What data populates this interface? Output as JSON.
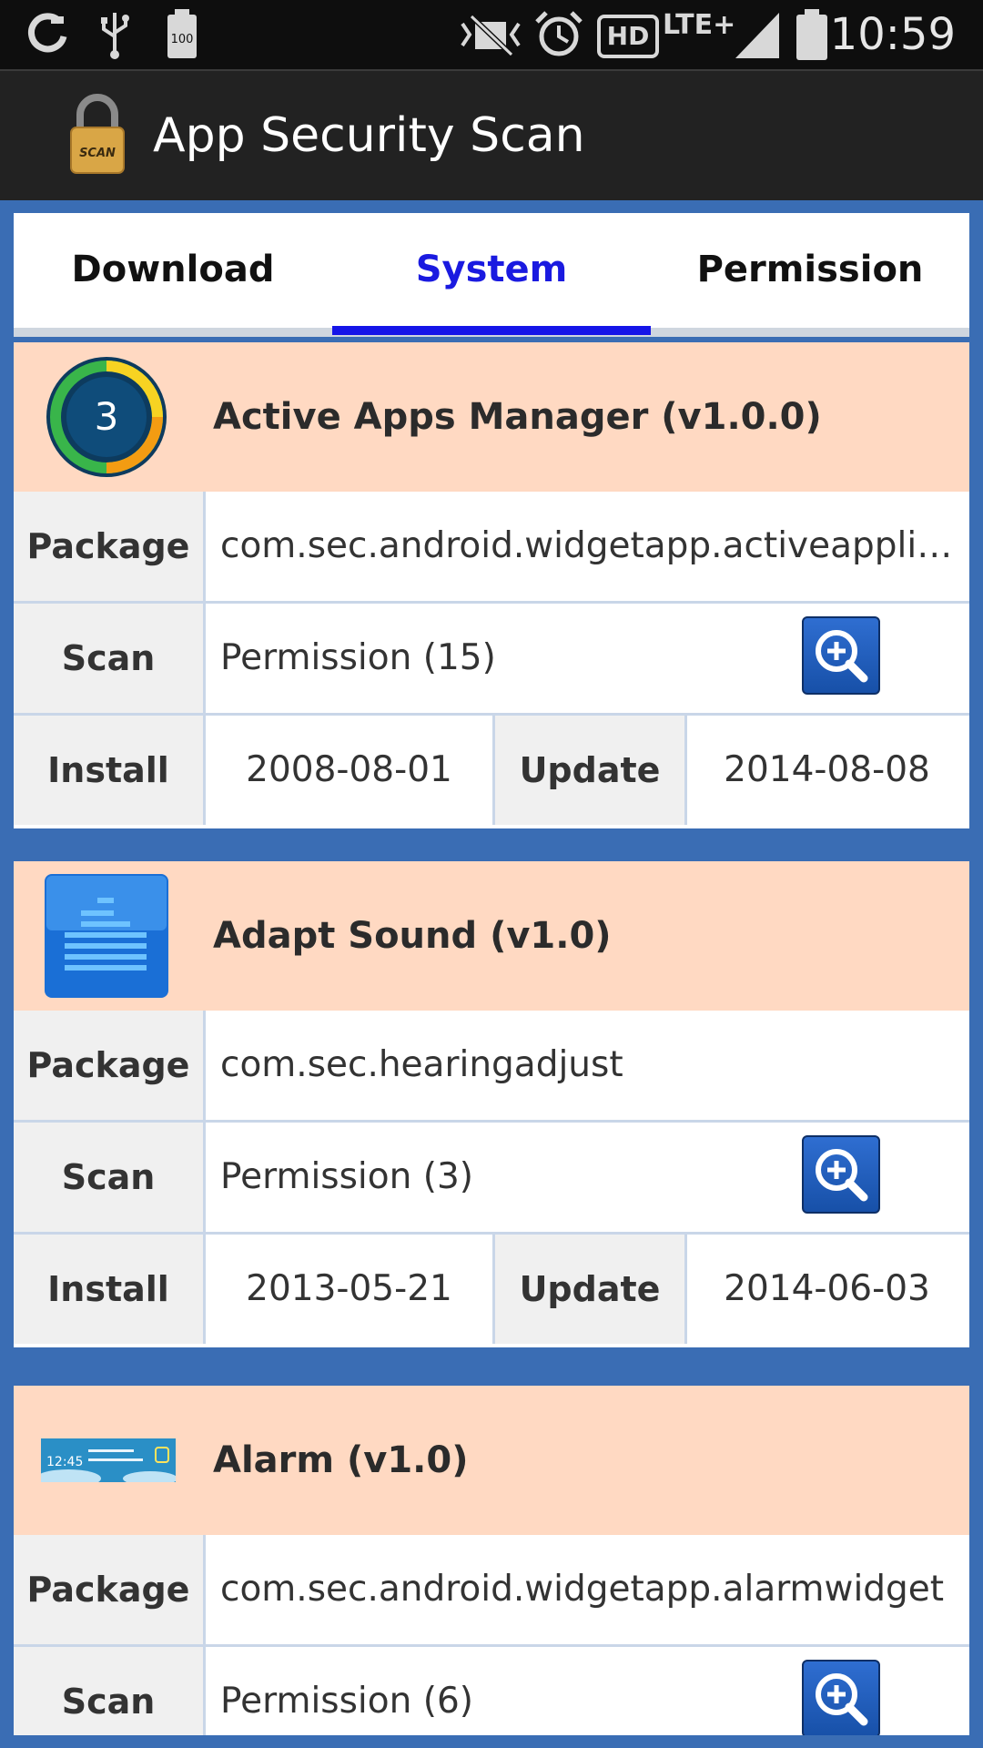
{
  "status_bar": {
    "time": "10:59",
    "battery_small": "100",
    "network": "LTE+",
    "hd": "HD",
    "icons": [
      "sync-icon",
      "usb-icon",
      "battery-saver-icon",
      "vibrate-icon",
      "alarm-icon",
      "hd-voice-icon",
      "lte-icon",
      "signal-icon",
      "battery-icon"
    ]
  },
  "app_bar": {
    "title": "App Security Scan",
    "icon_label": "SCAN"
  },
  "tabs": [
    {
      "label": "Download",
      "active": false
    },
    {
      "label": "System",
      "active": true
    },
    {
      "label": "Permission",
      "active": false
    }
  ],
  "labels": {
    "package": "Package",
    "scan": "Scan",
    "install": "Install",
    "update": "Update"
  },
  "apps": [
    {
      "name": "Active Apps Manager (v1.0.0)",
      "icon": "active-apps-manager-icon",
      "icon_text": "3",
      "package": "com.sec.android.widgetapp.activeapplicat…",
      "scan": "Permission (15)",
      "install": "2008-08-01",
      "update": "2014-08-08"
    },
    {
      "name": "Adapt Sound (v1.0)",
      "icon": "adapt-sound-icon",
      "package": "com.sec.hearingadjust",
      "scan": "Permission (3)",
      "install": "2013-05-21",
      "update": "2014-06-03"
    },
    {
      "name": "Alarm (v1.0)",
      "icon": "alarm-widget-icon",
      "icon_time": "12:45",
      "package": "com.sec.android.widgetapp.alarmwidget",
      "scan": "Permission (6)"
    }
  ],
  "colors": {
    "background": "#3a6db4",
    "header": "#ffd9c2",
    "active_tab": "#1515e8",
    "status_bar": "#0e0e0e",
    "action_bar": "#222222"
  }
}
